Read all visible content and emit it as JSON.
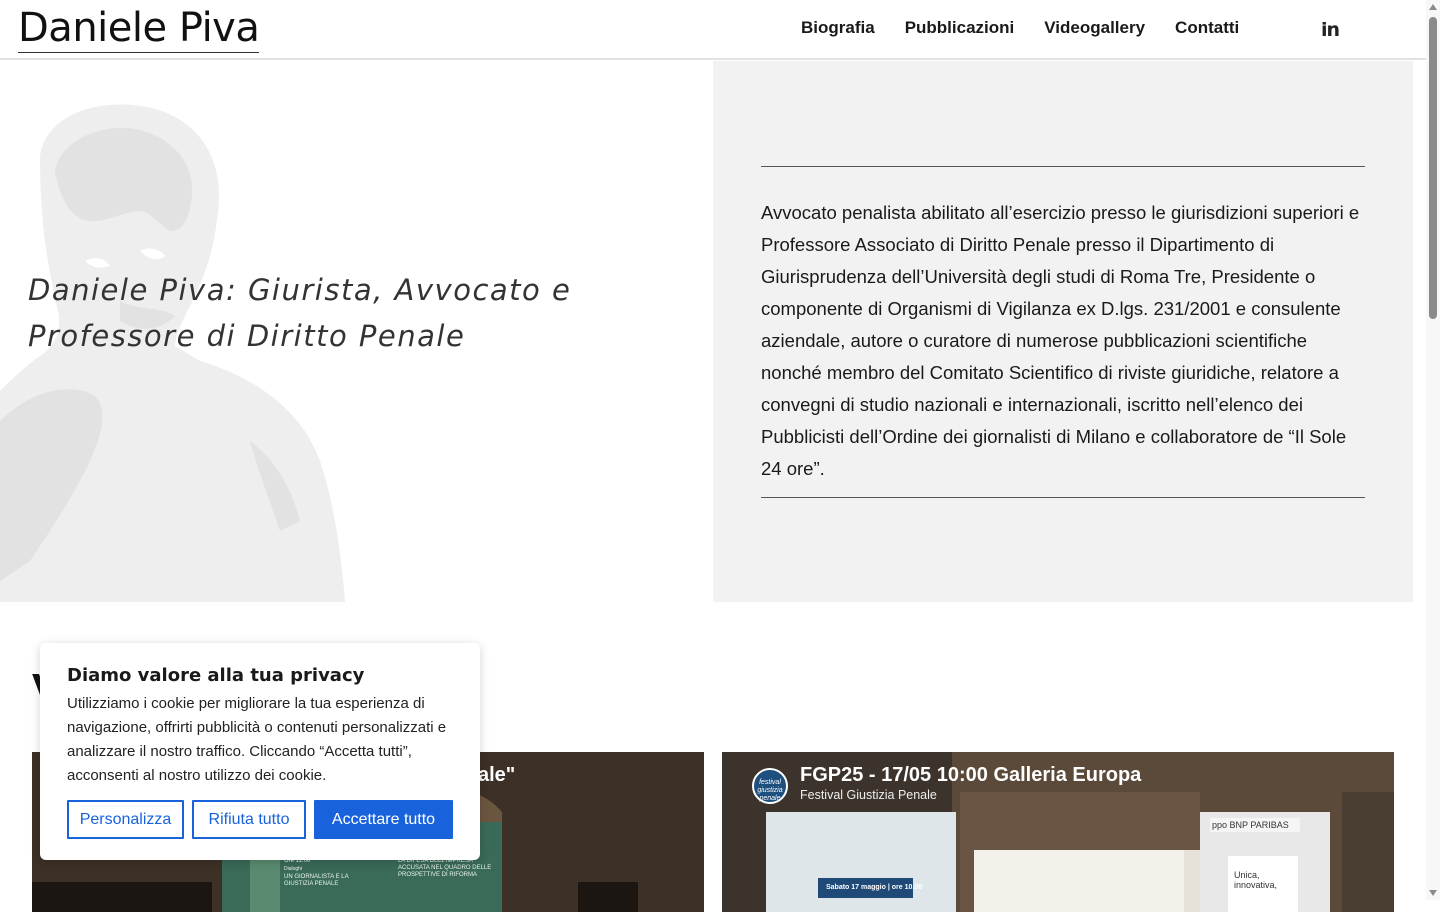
{
  "header": {
    "logo": "Daniele Piva",
    "nav": [
      "Biografia",
      "Pubblicazioni",
      "Videogallery",
      "Contatti"
    ],
    "social": "in"
  },
  "hero": {
    "title": "Daniele Piva: Giurista, Avvocato e Professore di Diritto Penale",
    "bio": "Avvocato penalista abilitato all’esercizio presso le giurisdizioni superiori e Professore Associato di Diritto Penale presso il Dipartimento di Giurisprudenza dell’Università degli studi di Roma Tre, Presidente o componente di Organismi di Vigilanza ex D.lgs. 231/2001 e consulente aziendale, autore o curatore di numerose pubblicazioni scientifiche nonché membro del Comitato Scientifico di riviste giuridiche, relatore a convegni di studio nazionali e internazionali, iscritto nell’elenco dei Pubblicisti dell’Ordine dei giornalisti di Milano e collaboratore de “Il Sole 24 ore”."
  },
  "section": {
    "heading_initial": "V"
  },
  "videos": [
    {
      "title_partial": "ale\"",
      "slide_lines": [
        "Ore 11.00",
        "Dialoghi",
        "UN GIORNALISTA E LA GIUSTIZIA PENALE",
        "LA DIFESA DELL'IMPRESA ACCUSATA NEL QUADRO DELLE PROSPETTIVE DI RIFORMA"
      ]
    },
    {
      "title": "FGP25 - 17/05 10:00 Galleria Europa",
      "channel": "Festival Giustizia Penale",
      "avatar_text": "festival giustizia penale",
      "banner_text": "Sabato 17 maggio | ore 10.00",
      "bank_sign": "ppo BNP PARIBAS",
      "poster_text": "Unica, innovativa,"
    }
  ],
  "cookie": {
    "title": "Diamo valore alla tua privacy",
    "text": "Utilizziamo i cookie per migliorare la tua esperienza di navigazione, offrirti pubblicità o contenuti personalizzati e analizzare il nostro traffico. Cliccando “Accetta tutti”, acconsenti al nostro utilizzo dei cookie.",
    "buttons": {
      "customize": "Personalizza",
      "reject": "Rifiuta tutto",
      "accept": "Accettare tutto"
    },
    "accent_color": "#1863dc"
  }
}
